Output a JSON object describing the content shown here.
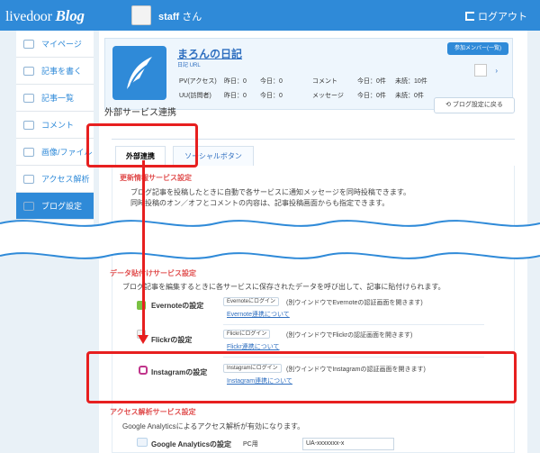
{
  "header": {
    "logo_primary": "livedoor",
    "logo_secondary": "Blog",
    "user_name": "staff",
    "user_suffix": "さん",
    "logout_label": "ログアウト"
  },
  "sidebar": {
    "items": [
      {
        "label": "マイページ"
      },
      {
        "label": "記事を書く"
      },
      {
        "label": "記事一覧"
      },
      {
        "label": "コメント"
      },
      {
        "label": "画像/ファイル"
      },
      {
        "label": "アクセス解析"
      },
      {
        "label": "ブログ設定"
      }
    ]
  },
  "blog_card": {
    "title": "まろんの日記",
    "links": [
      "日記",
      "URL"
    ],
    "pv_label": "PV(アクセス)",
    "uu_label": "UU(訪問者)",
    "pv_yesterday": "昨日：0",
    "pv_today": "今日：0",
    "uu_yesterday": "昨日：0",
    "uu_today": "今日：0",
    "comment_label": "コメント",
    "message_label": "メッセージ",
    "comment_today": "今日：0件",
    "comment_unread": "未読：10件",
    "message_today": "今日：0件",
    "message_unread": "未読：0件",
    "member_button": "参加メンバー(一覧)"
  },
  "page": {
    "section_title": "外部サービス連携",
    "back_button": "ブログ設定に戻る",
    "tabs": [
      "外部連携",
      "ソーシャルボタン"
    ]
  },
  "sections": [
    {
      "head": "更新情報サービス設定",
      "desc1": "ブログ記事を投稿したときに自動で各サービスに通知メッセージを同時投稿できます。",
      "desc2": "同時投稿のオン／オフとコメントの内容は、記事投稿画面からも指定できます。"
    },
    {
      "head": "データ貼付けサービス設定",
      "desc": "ブログ記事を編集するときに各サービスに保存されたデータを呼び出して、記事に貼付けられます。",
      "rows": [
        {
          "name": "Evernoteの設定",
          "button": "Evernoteにログイン",
          "note": "(別ウインドウでEvernoteの認証画面を開きます)",
          "help": "Evernote連携について"
        },
        {
          "name": "Flickrの設定",
          "button": "Flickrにログイン",
          "note": "(別ウインドウでFlickrの認証画面を開きます)",
          "help": "Flickr連携について"
        },
        {
          "name": "Instagramの設定",
          "button": "Instagramにログイン",
          "note": "(別ウインドウでInstagramの認証画面を開きます)",
          "help": "Instagram連携について"
        }
      ]
    },
    {
      "head": "アクセス解析サービス設定",
      "desc": "Google Analyticsによるアクセス解析が有効になります。",
      "row": {
        "name": "Google Analyticsの設定",
        "field_label": "PC用",
        "placeholder": "UA-xxxxxxx-x"
      }
    }
  ],
  "colors": {
    "primary": "#2f8ad8",
    "highlight": "#e71f1f"
  }
}
